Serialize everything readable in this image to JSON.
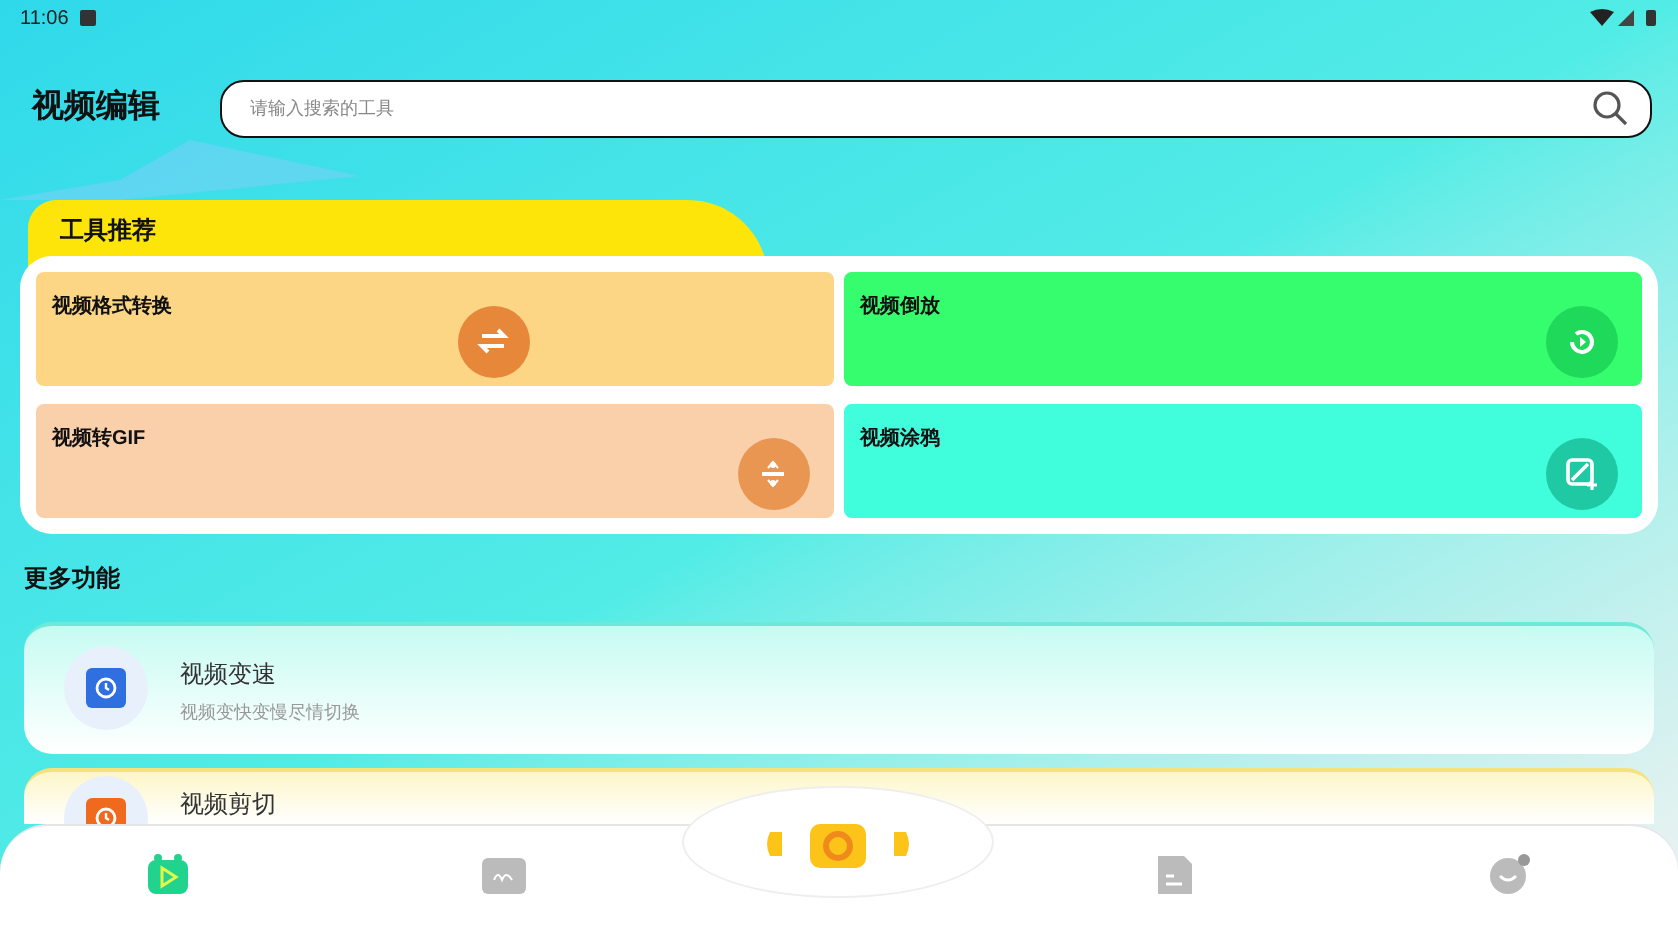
{
  "status_bar": {
    "time": "11:06"
  },
  "header": {
    "title": "视频编辑",
    "search": {
      "placeholder": "请输入搜索的工具"
    }
  },
  "recommended": {
    "title": "工具推荐",
    "tools": [
      {
        "label": "视频格式转换",
        "color": "#fcd685"
      },
      {
        "label": "视频倒放",
        "color": "#35fd6d"
      },
      {
        "label": "视频转GIF",
        "color": "#fad0ab"
      },
      {
        "label": "视频涂鸦",
        "color": "#40fddc"
      }
    ]
  },
  "more": {
    "title": "更多功能",
    "items": [
      {
        "title": "视频变速",
        "subtitle": "视频变快变慢尽情切换",
        "color": "#2f6fe0"
      },
      {
        "title": "视频剪切",
        "color": "#f06a1e"
      }
    ]
  },
  "bottom_nav": [
    {
      "kind": "tab",
      "selected": true
    },
    {
      "kind": "tab",
      "selected": false
    },
    {
      "kind": "center",
      "selected": false
    },
    {
      "kind": "tab",
      "selected": false
    },
    {
      "kind": "tab",
      "selected": false
    }
  ]
}
